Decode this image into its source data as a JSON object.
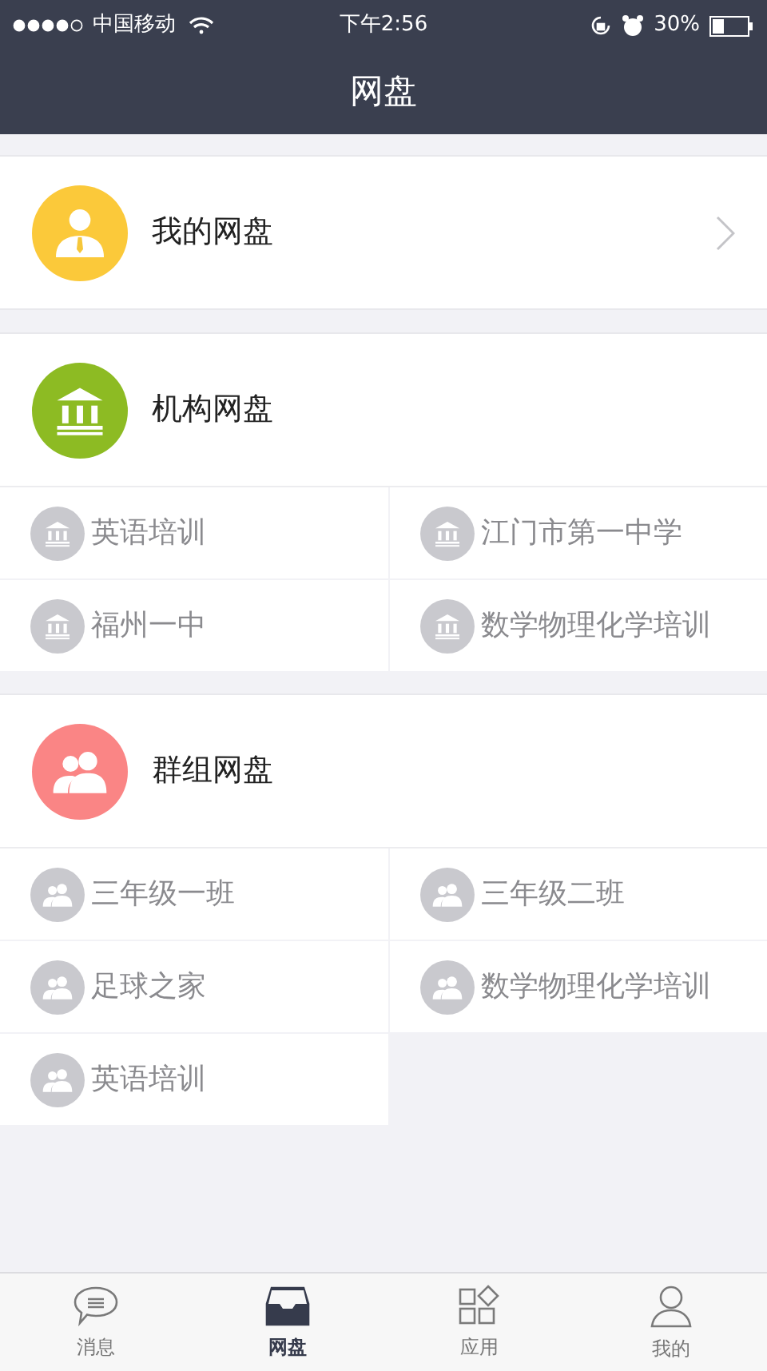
{
  "status_bar": {
    "carrier": "中国移动",
    "time": "下午2:56",
    "battery": "30%"
  },
  "nav": {
    "title": "网盘"
  },
  "sections": [
    {
      "kind": "personal",
      "title": "我的网盘"
    },
    {
      "kind": "org",
      "title": "机构网盘",
      "items": [
        "英语培训",
        "江门市第一中学",
        "福州一中",
        "数学物理化学培训"
      ]
    },
    {
      "kind": "group",
      "title": "群组网盘",
      "items": [
        "三年级一班",
        "三年级二班",
        "足球之家",
        "数学物理化学培训",
        "英语培训"
      ]
    }
  ],
  "tabs": [
    {
      "kind": "chat",
      "label": "消息",
      "selected": false
    },
    {
      "kind": "tray",
      "label": "网盘",
      "selected": true
    },
    {
      "kind": "apps",
      "label": "应用",
      "selected": false
    },
    {
      "kind": "person",
      "label": "我的",
      "selected": false
    }
  ]
}
